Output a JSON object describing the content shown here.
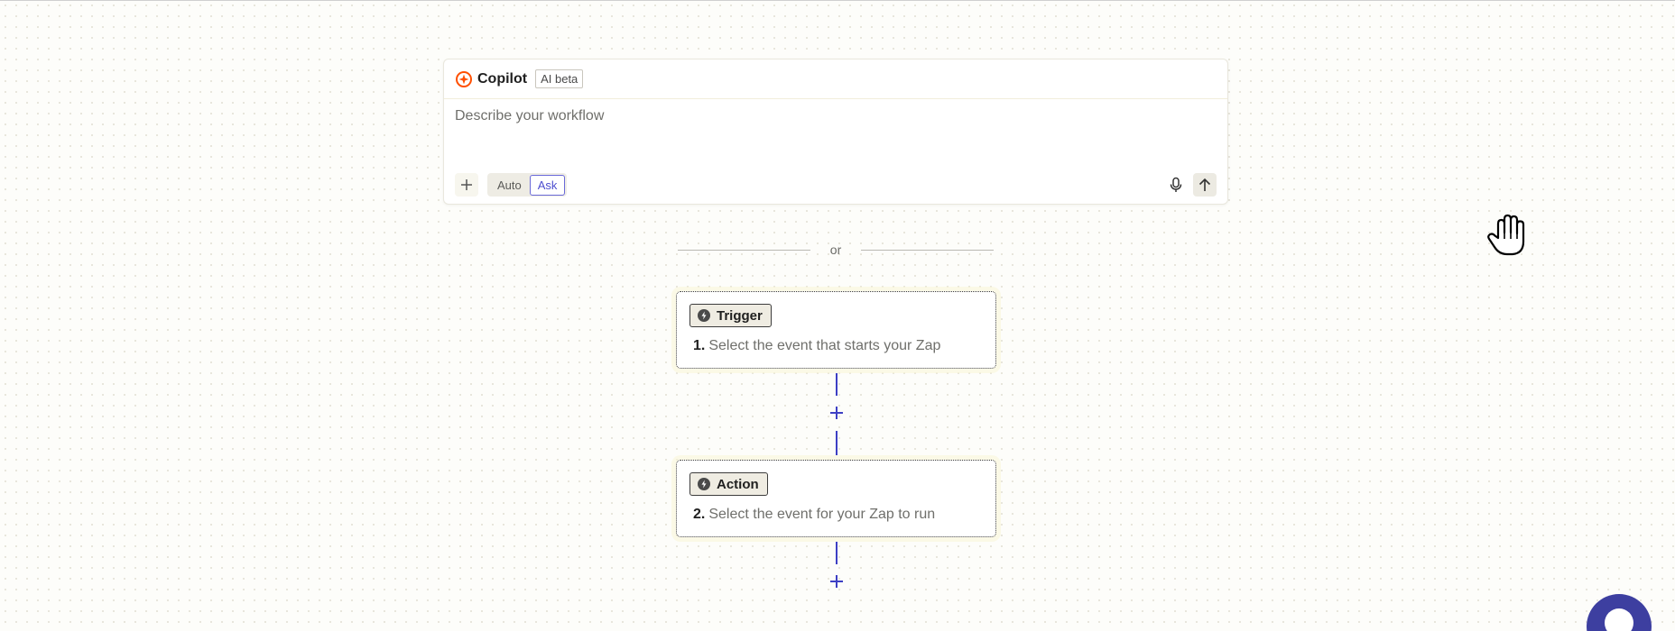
{
  "copilot": {
    "title": "Copilot",
    "badge": "AI beta",
    "input_placeholder": "Describe your workflow",
    "input_value": "",
    "modes": [
      "Auto",
      "Ask"
    ],
    "active_mode": "Ask"
  },
  "divider": {
    "text": "or"
  },
  "steps": [
    {
      "pill": "Trigger",
      "number": "1.",
      "description": "Select the event that starts your Zap"
    },
    {
      "pill": "Action",
      "number": "2.",
      "description": "Select the event for your Zap to run"
    }
  ],
  "icons": {
    "copilot_logo": "copilot-logo-icon",
    "add": "plus-icon",
    "mic": "microphone-icon",
    "send": "arrow-up-icon",
    "step": "bolt-icon",
    "cursor": "hand-grab-icon"
  },
  "colors": {
    "accent": "#3d3fc4",
    "active_mode_text": "#4d4ecf",
    "help_button": "#3d3fa0",
    "logo": "#ff4f00"
  }
}
